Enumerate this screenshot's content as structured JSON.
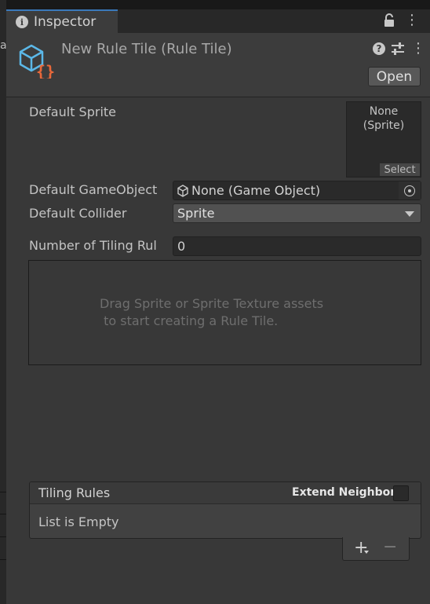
{
  "tab": {
    "label": "Inspector"
  },
  "edge": {
    "letter": "a"
  },
  "header": {
    "title": "New Rule Tile (Rule Tile)",
    "help_glyph": "?",
    "menu_glyph": "⋮",
    "open_label": "Open"
  },
  "fields": {
    "default_sprite_label": "Default Sprite",
    "sprite_none_line1": "None",
    "sprite_none_line2": "(Sprite)",
    "sprite_select": "Select",
    "default_gameobject_label": "Default GameObject",
    "gameobject_value": "None (Game Object)",
    "default_collider_label": "Default Collider",
    "collider_value": "Sprite",
    "tiling_count_label": "Number of Tiling Rul",
    "tiling_count_value": "0"
  },
  "dropzone": {
    "text": "Drag Sprite or Sprite Texture assets\n to start creating a Rule Tile."
  },
  "rules": {
    "title": "Tiling Rules",
    "extend_label": "Extend Neighbor",
    "extend_checked": false,
    "empty_text": "List is Empty",
    "add_glyph": "+",
    "remove_glyph": "−"
  },
  "colors": {
    "tab_accent": "#3a79bb",
    "icon_cube": "#5bb8e8",
    "icon_braces": "#e8683a"
  }
}
